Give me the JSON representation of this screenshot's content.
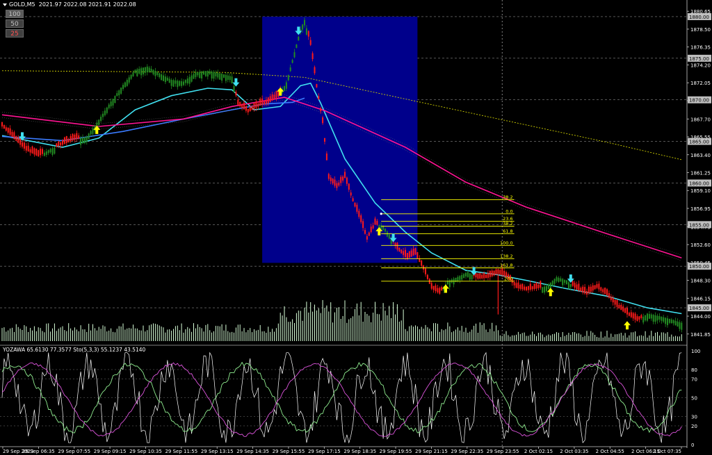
{
  "header": {
    "symbol": "GOLD,M5",
    "ohlc": "2021.97 2022.08 2021.91 2022.08"
  },
  "buttons": [
    {
      "label": "100",
      "color": "#c0c0c0",
      "bg": "#5a5a5a"
    },
    {
      "label": "50",
      "color": "#c0c0c0",
      "bg": "#404040"
    },
    {
      "label": "25",
      "color": "#ff5050",
      "bg": "#404040"
    }
  ],
  "oscillator_label": "YOZAWA 65.6130 77.3577  Sto(5,3,3) 55.1237 43.5140",
  "colors": {
    "background": "#000000",
    "bull_candle": "#228b22",
    "bear_candle": "#ff1a1a",
    "highlight_box": "#00008b",
    "ma_cyan": "#40e0f0",
    "ma_blue": "#3a7bff",
    "ma_pink": "#ff1493",
    "ma_yellow": "#cfcf00",
    "fib": "#ffff00",
    "volume": "#d8ffd8",
    "arrow_up": "#ffff00",
    "arrow_down": "#40e0f0",
    "osc_main": "#ffffff",
    "osc_green": "#90ee90",
    "osc_magenta": "#dd55dd"
  },
  "chart_data": {
    "type": "line",
    "title": "",
    "price_axis": {
      "ylim": [
        1841.0,
        1881.5
      ],
      "tick_labels": [
        "1880.65",
        "1878.50",
        "1876.35",
        "1874.20",
        "1872.05",
        "1869.90",
        "1867.70",
        "1865.55",
        "1863.40",
        "1861.25",
        "1859.10",
        "1856.95",
        "1854.75",
        "1852.60",
        "1850.45",
        "1848.30",
        "1846.15",
        "1844.00",
        "1841.85"
      ],
      "ticks": [
        1880.65,
        1878.5,
        1876.35,
        1874.2,
        1872.05,
        1869.9,
        1867.7,
        1865.55,
        1863.4,
        1861.25,
        1859.1,
        1856.95,
        1854.75,
        1852.6,
        1850.45,
        1848.3,
        1846.15,
        1844.0,
        1841.85
      ],
      "level_labels": [
        "1880.00",
        "1875.00",
        "1870.00",
        "1865.00",
        "1860.00",
        "1855.00",
        "1850.00",
        "1845.00"
      ],
      "levels": [
        1880,
        1875,
        1870,
        1865,
        1860,
        1855,
        1850,
        1845
      ]
    },
    "time_axis": {
      "labels": [
        "29 Sep 2023",
        "29 Sep 06:35",
        "29 Sep 07:55",
        "29 Sep 09:15",
        "29 Sep 10:35",
        "29 Sep 11:55",
        "29 Sep 13:15",
        "29 Sep 14:35",
        "29 Sep 15:55",
        "29 Sep 17:15",
        "29 Sep 18:35",
        "29 Sep 19:55",
        "29 Sep 21:15",
        "29 Sep 22:35",
        "29 Sep 23:55",
        "2 Oct 02:15",
        "2 Oct 03:35",
        "2 Oct 04:55",
        "2 Oct 06:15",
        "2 Oct 07:35"
      ]
    },
    "price_series": [
      {
        "bar": 0,
        "close": 1866.8,
        "dir": "bear"
      },
      {
        "bar": 6,
        "close": 1865.3,
        "dir": "bear"
      },
      {
        "bar": 12,
        "close": 1863.9,
        "dir": "bear"
      },
      {
        "bar": 18,
        "close": 1863.2,
        "dir": "bear"
      },
      {
        "bar": 24,
        "close": 1864.1,
        "dir": "bull"
      },
      {
        "bar": 30,
        "close": 1864.6,
        "dir": "bear"
      },
      {
        "bar": 36,
        "close": 1865.2,
        "dir": "bear"
      },
      {
        "bar": 42,
        "close": 1865.6,
        "dir": "bull"
      },
      {
        "bar": 48,
        "close": 1867.6,
        "dir": "bull"
      },
      {
        "bar": 54,
        "close": 1869.8,
        "dir": "bull"
      },
      {
        "bar": 60,
        "close": 1871.8,
        "dir": "bull"
      },
      {
        "bar": 66,
        "close": 1873.6,
        "dir": "bull"
      },
      {
        "bar": 72,
        "close": 1874.0,
        "dir": "bull"
      },
      {
        "bar": 78,
        "close": 1873.2,
        "dir": "bull"
      },
      {
        "bar": 84,
        "close": 1872.4,
        "dir": "bull"
      },
      {
        "bar": 90,
        "close": 1872.2,
        "dir": "bull"
      },
      {
        "bar": 96,
        "close": 1873.3,
        "dir": "bull"
      },
      {
        "bar": 102,
        "close": 1873.5,
        "dir": "bull"
      },
      {
        "bar": 108,
        "close": 1873.2,
        "dir": "bull"
      },
      {
        "bar": 114,
        "close": 1872.8,
        "dir": "bull"
      },
      {
        "bar": 117,
        "close": 1869.4,
        "dir": "bear"
      },
      {
        "bar": 122,
        "close": 1868.5,
        "dir": "bear"
      },
      {
        "bar": 128,
        "close": 1869.3,
        "dir": "bear"
      },
      {
        "bar": 132,
        "close": 1869.6,
        "dir": "bear"
      },
      {
        "bar": 137,
        "close": 1870.4,
        "dir": "bear"
      },
      {
        "bar": 141,
        "close": 1872.1,
        "dir": "bull"
      },
      {
        "bar": 144,
        "close": 1874.8,
        "dir": "bull"
      },
      {
        "bar": 148,
        "close": 1878.5,
        "dir": "bull"
      },
      {
        "bar": 150,
        "close": 1879.6,
        "dir": "bull"
      },
      {
        "bar": 153,
        "close": 1876.6,
        "dir": "bear"
      },
      {
        "bar": 156,
        "close": 1871.5,
        "dir": "bear"
      },
      {
        "bar": 159,
        "close": 1867.2,
        "dir": "bear"
      },
      {
        "bar": 162,
        "close": 1860.5,
        "dir": "bear"
      },
      {
        "bar": 166,
        "close": 1859.4,
        "dir": "bear"
      },
      {
        "bar": 170,
        "close": 1860.6,
        "dir": "bear"
      },
      {
        "bar": 174,
        "close": 1857.8,
        "dir": "bear"
      },
      {
        "bar": 178,
        "close": 1855.3,
        "dir": "bear"
      },
      {
        "bar": 181,
        "close": 1853.2,
        "dir": "bear"
      },
      {
        "bar": 185,
        "close": 1855.0,
        "dir": "bear"
      },
      {
        "bar": 189,
        "close": 1854.9,
        "dir": "bull"
      },
      {
        "bar": 192,
        "close": 1853.8,
        "dir": "bull"
      },
      {
        "bar": 196,
        "close": 1852.0,
        "dir": "bear"
      },
      {
        "bar": 201,
        "close": 1850.9,
        "dir": "bear"
      },
      {
        "bar": 205,
        "close": 1851.4,
        "dir": "bear"
      },
      {
        "bar": 209,
        "close": 1849.6,
        "dir": "bear"
      },
      {
        "bar": 213,
        "close": 1847.3,
        "dir": "bear"
      },
      {
        "bar": 217,
        "close": 1846.7,
        "dir": "bear"
      },
      {
        "bar": 221,
        "close": 1848.2,
        "dir": "bull"
      },
      {
        "bar": 226,
        "close": 1848.7,
        "dir": "bull"
      },
      {
        "bar": 231,
        "close": 1849.3,
        "dir": "bull"
      },
      {
        "bar": 236,
        "close": 1848.5,
        "dir": "bear"
      },
      {
        "bar": 241,
        "close": 1848.6,
        "dir": "bear"
      },
      {
        "bar": 246,
        "close": 1849.1,
        "dir": "bear"
      },
      {
        "bar": 249,
        "close": 1848.8,
        "dir": "bear"
      },
      {
        "bar": 252,
        "close": 1848.3,
        "dir": "bear"
      },
      {
        "bar": 255,
        "close": 1847.4,
        "dir": "bear"
      },
      {
        "bar": 260,
        "close": 1847.1,
        "dir": "bear"
      },
      {
        "bar": 265,
        "close": 1847.3,
        "dir": "bear"
      },
      {
        "bar": 270,
        "close": 1847.6,
        "dir": "bull"
      },
      {
        "bar": 275,
        "close": 1848.7,
        "dir": "bull"
      },
      {
        "bar": 280,
        "close": 1848.3,
        "dir": "bull"
      },
      {
        "bar": 285,
        "close": 1847.2,
        "dir": "bear"
      },
      {
        "bar": 290,
        "close": 1846.6,
        "dir": "bear"
      },
      {
        "bar": 295,
        "close": 1847.4,
        "dir": "bear"
      },
      {
        "bar": 300,
        "close": 1846.5,
        "dir": "bear"
      },
      {
        "bar": 305,
        "close": 1845.1,
        "dir": "bear"
      },
      {
        "bar": 310,
        "close": 1844.2,
        "dir": "bear"
      },
      {
        "bar": 315,
        "close": 1843.4,
        "dir": "bear"
      },
      {
        "bar": 320,
        "close": 1844.3,
        "dir": "bull"
      },
      {
        "bar": 326,
        "close": 1844.0,
        "dir": "bull"
      },
      {
        "bar": 332,
        "close": 1843.6,
        "dir": "bull"
      },
      {
        "bar": 337,
        "close": 1843.2,
        "dir": "bull"
      }
    ],
    "spike_low": {
      "bar": 246,
      "low": 1844.2
    },
    "moving_averages": [
      {
        "name": "cyan",
        "points": [
          [
            0,
            1865.7
          ],
          [
            30,
            1864.3
          ],
          [
            48,
            1865.4
          ],
          [
            66,
            1868.8
          ],
          [
            84,
            1870.5
          ],
          [
            102,
            1871.4
          ],
          [
            114,
            1871.2
          ],
          [
            125,
            1868.8
          ],
          [
            138,
            1869.2
          ],
          [
            148,
            1871.7
          ],
          [
            153,
            1872.0
          ],
          [
            158,
            1869.6
          ],
          [
            170,
            1862.9
          ],
          [
            185,
            1857.6
          ],
          [
            200,
            1854.1
          ],
          [
            213,
            1851.6
          ],
          [
            230,
            1849.5
          ],
          [
            245,
            1849.0
          ],
          [
            260,
            1848.3
          ],
          [
            280,
            1847.3
          ],
          [
            300,
            1846.4
          ],
          [
            320,
            1845.0
          ],
          [
            337,
            1844.3
          ]
        ]
      },
      {
        "name": "blue",
        "points": [
          [
            0,
            1865.6
          ],
          [
            30,
            1865.1
          ],
          [
            60,
            1866.2
          ],
          [
            90,
            1867.7
          ],
          [
            114,
            1868.8
          ],
          [
            130,
            1869.5
          ],
          [
            144,
            1869.7
          ],
          [
            150,
            1870.2
          ]
        ]
      },
      {
        "name": "pink",
        "points": [
          [
            0,
            1868.2
          ],
          [
            48,
            1866.8
          ],
          [
            90,
            1867.7
          ],
          [
            114,
            1869.2
          ],
          [
            140,
            1870.3
          ],
          [
            160,
            1868.7
          ],
          [
            200,
            1864.3
          ],
          [
            230,
            1860.1
          ],
          [
            260,
            1857.1
          ],
          [
            300,
            1853.9
          ],
          [
            337,
            1851.0
          ]
        ]
      },
      {
        "name": "yellow",
        "points": [
          [
            0,
            1873.5
          ],
          [
            110,
            1873.3
          ],
          [
            150,
            1872.7
          ],
          [
            200,
            1870.1
          ],
          [
            250,
            1867.5
          ],
          [
            300,
            1864.9
          ],
          [
            337,
            1862.8
          ]
        ]
      }
    ],
    "signal_arrows": [
      {
        "bar": 10,
        "price": 1865.6,
        "dir": "down"
      },
      {
        "bar": 47,
        "price": 1866.4,
        "dir": "up"
      },
      {
        "bar": 116,
        "price": 1872.1,
        "dir": "down"
      },
      {
        "bar": 138,
        "price": 1871.0,
        "dir": "up"
      },
      {
        "bar": 147,
        "price": 1878.3,
        "dir": "down"
      },
      {
        "bar": 187,
        "price": 1854.2,
        "dir": "up"
      },
      {
        "bar": 194,
        "price": 1853.4,
        "dir": "down"
      },
      {
        "bar": 220,
        "price": 1847.3,
        "dir": "up"
      },
      {
        "bar": 234,
        "price": 1849.4,
        "dir": "down"
      },
      {
        "bar": 272,
        "price": 1846.9,
        "dir": "up"
      },
      {
        "bar": 282,
        "price": 1848.5,
        "dir": "down"
      },
      {
        "bar": 310,
        "price": 1842.9,
        "dir": "up"
      }
    ],
    "highlight_zone": {
      "bar_start": 129,
      "bar_end": 206,
      "price_high": 1880.0,
      "price_low": 1850.4
    },
    "fibonacci": {
      "bar_start": 188,
      "bar_end": 254,
      "levels": [
        {
          "label": "38.2",
          "price": 1858.0
        },
        {
          "label": "0.0",
          "price": 1856.3
        },
        {
          "label": "23.6",
          "price": 1855.4
        },
        {
          "label": "38.2",
          "price": 1854.8
        },
        {
          "label": "61.8",
          "price": 1853.9
        },
        {
          "label": "100.0",
          "price": 1852.5
        },
        {
          "label": "138.2",
          "price": 1850.9
        },
        {
          "label": "161.8",
          "price": 1849.8
        },
        {
          "label": "200",
          "price": 1848.2
        }
      ]
    },
    "oscillator": {
      "ylim": [
        0,
        100
      ],
      "tick_labels": [
        "100",
        "80",
        "70",
        "50",
        "30",
        "20",
        "0"
      ],
      "ticks": [
        100,
        80,
        70,
        50,
        30,
        20,
        0
      ]
    }
  }
}
